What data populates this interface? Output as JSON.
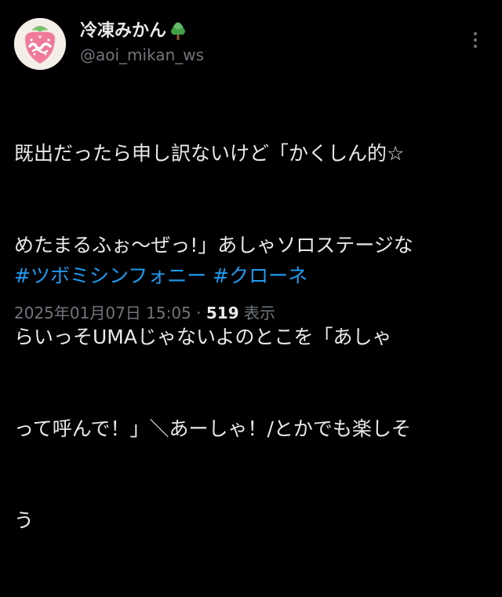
{
  "author": {
    "display_name": "冷凍みかん",
    "handle": "@aoi_mikan_ws",
    "avatar_icon": "strawberry-avatar-icon",
    "name_emoji_icon": "tree-icon"
  },
  "tweet": {
    "lines": [
      "既出だったら申し訳ないけど「かくしん的☆",
      "めたまるふぉ〜ぜっ!」あしゃソロステージな",
      "らいっそUMAじゃないよのとこを「あしゃ",
      "って呼んで！」＼あーしゃ！/とかでも楽しそ",
      "う"
    ],
    "hashtags": [
      "#ツボミシンフォニー",
      "#クローネ"
    ]
  },
  "meta": {
    "timestamp": "2025年01月07日 15:05",
    "separator": "·",
    "views_count": "519",
    "views_label": "表示"
  },
  "colors": {
    "background": "#000000",
    "text": "#e7e9ea",
    "secondary": "#71767b",
    "link": "#1d9bf0"
  }
}
